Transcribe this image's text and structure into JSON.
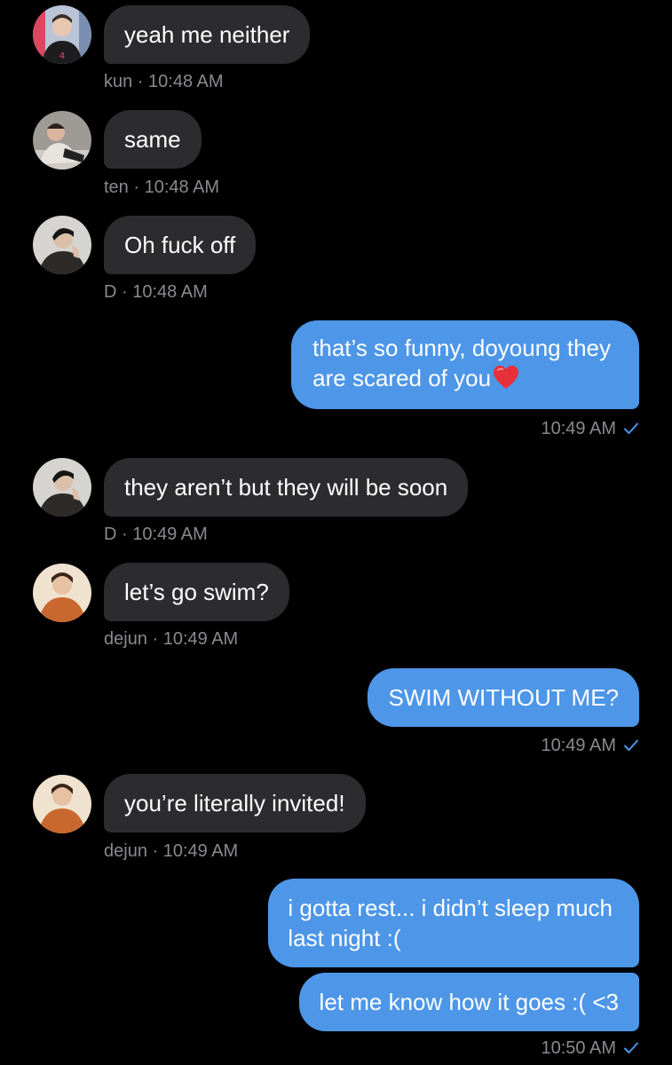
{
  "messages": [
    {
      "text": "yeah me neither",
      "sender": "kun",
      "time": "10:48 AM"
    },
    {
      "text": "same",
      "sender": "ten",
      "time": "10:48 AM"
    },
    {
      "text": "Oh fuck off",
      "sender": "D",
      "time": "10:48 AM"
    },
    {
      "line1": "that’s so funny, doyoung they",
      "line2": "are scared of you",
      "emoji": "heart",
      "time": "10:49 AM"
    },
    {
      "text": "they aren’t but they will be soon",
      "sender": "D",
      "time": "10:49 AM"
    },
    {
      "text": "let’s go swim?",
      "sender": "dejun",
      "time": "10:49 AM"
    },
    {
      "text": "SWIM WITHOUT ME?",
      "time": "10:49 AM"
    },
    {
      "text": "you’re literally invited!",
      "sender": "dejun",
      "time": "10:49 AM"
    },
    {
      "line1": "i gotta rest... i didn’t sleep much",
      "line2": "last night :("
    },
    {
      "text": "let me know how it goes :( <3",
      "time": "10:50 AM"
    }
  ],
  "separator": " · ",
  "colors": {
    "background": "#000000",
    "incoming_bubble": "#2c2c2e",
    "outgoing_bubble": "#4d96e8",
    "meta_text": "#8a8a8e",
    "read_check": "#4d96e8"
  },
  "icons": {
    "read_receipt": "checkmark-icon",
    "emoji": "red-heart-icon"
  }
}
